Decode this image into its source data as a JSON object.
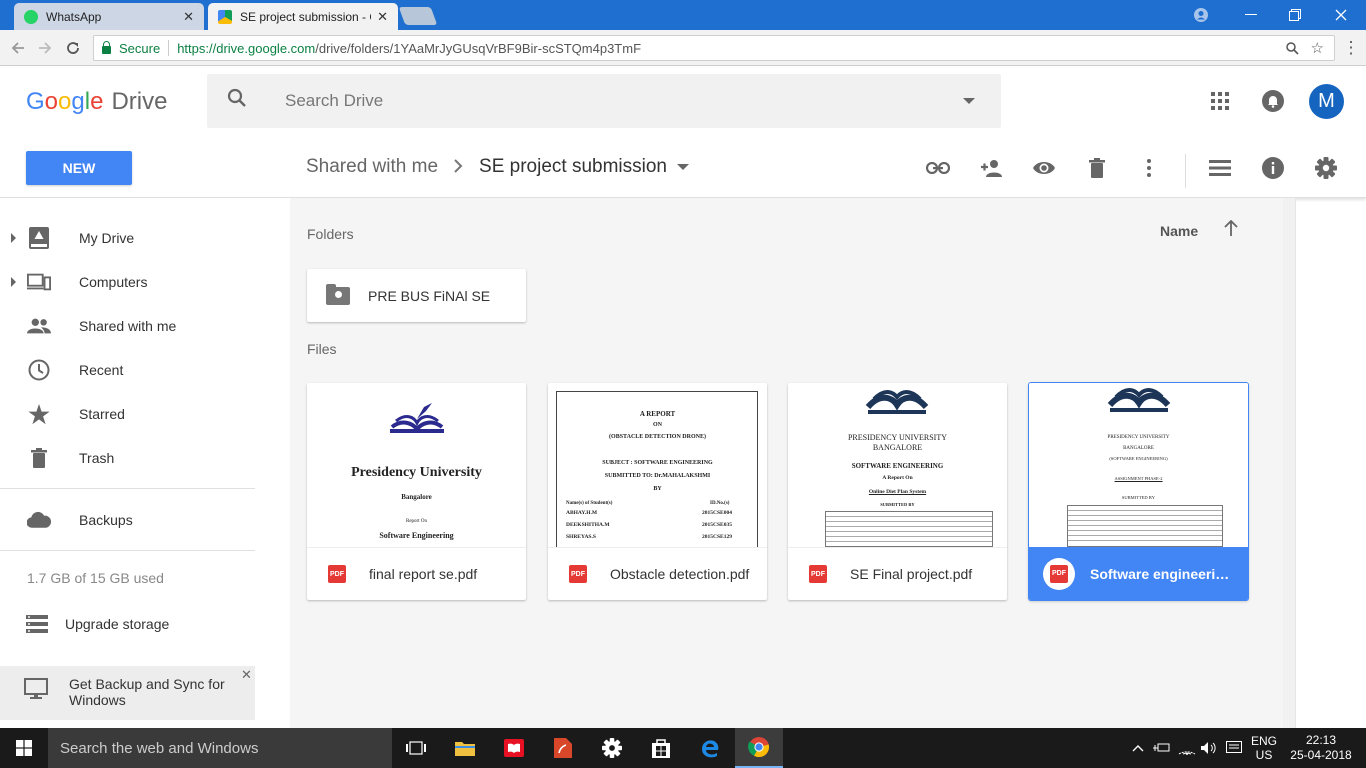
{
  "browser": {
    "tabs": [
      {
        "label": "WhatsApp",
        "icon": "whatsapp-icon",
        "active": false
      },
      {
        "label": "SE project submission - G",
        "icon": "google-drive-icon",
        "active": true
      }
    ],
    "close_glyph": "✕",
    "secure_label": "Secure",
    "url_domain": "https://drive.google.com",
    "url_path": "/drive/folders/1YAaMrJyGUsqVrBF9Bir-scSTQm4p3TmF"
  },
  "drive": {
    "logo_letters": [
      "G",
      "o",
      "o",
      "g",
      "l",
      "e"
    ],
    "logo_colors": [
      "#4285f4",
      "#ea4335",
      "#fbbc05",
      "#4285f4",
      "#34a853",
      "#ea4335"
    ],
    "logo_product": "Drive",
    "search_placeholder": "Search Drive",
    "avatar_initial": "M",
    "new_button": "NEW",
    "breadcrumb": {
      "parent": "Shared with me",
      "current": "SE project submission"
    },
    "sort_label": "Name",
    "accent_color": "#4285f4"
  },
  "nav": {
    "items": [
      {
        "label": "My Drive",
        "icon": "my-drive-icon"
      },
      {
        "label": "Computers",
        "icon": "computers-icon"
      },
      {
        "label": "Shared with me",
        "icon": "shared-icon"
      },
      {
        "label": "Recent",
        "icon": "clock-icon"
      },
      {
        "label": "Starred",
        "icon": "star-icon"
      },
      {
        "label": "Trash",
        "icon": "trash-icon"
      }
    ],
    "backups": "Backups",
    "storage": "1.7 GB of 15 GB used",
    "upgrade": "Upgrade storage",
    "backup_promo": "Get Backup and Sync for Windows"
  },
  "content": {
    "folders_title": "Folders",
    "files_title": "Files",
    "folders": [
      {
        "label": "PRE BUS FiNAl SE"
      }
    ],
    "files": [
      {
        "name": "final report se.pdf",
        "badge": "PDF"
      },
      {
        "name": "Obstacle detection.pdf",
        "badge": "PDF"
      },
      {
        "name": "SE Final project.pdf",
        "badge": "PDF"
      },
      {
        "name": "Software engineering.pdf",
        "badge": "PDF",
        "selected": true
      }
    ],
    "thumb1": {
      "title": "Presidency University",
      "city": "Bangalore",
      "report_on": "Report On",
      "subject": "Software Engineering"
    },
    "thumb2": {
      "l1": "A REPORT",
      "l2": "ON",
      "l3": "(OBSTACLE DETECTION DRONE)",
      "l4": "SUBJECT : SOFTWARE ENGINEERING",
      "l5": "SUBMITTED TO: Dr.MAHALAKSHMI",
      "l6": "BY",
      "col1": "Name(s) of Student(s)",
      "col2": "ID.No.(s)",
      "rows": [
        [
          "ABHAY.H.M",
          "2015CSE004"
        ],
        [
          "DEEKSHITHA.M",
          "2015CSE035"
        ],
        [
          "SHREYAS.S",
          "2015CSE129"
        ]
      ]
    },
    "thumb3": {
      "l1": "PRESIDENCY UNIVERSITY",
      "l2": "BANGALORE",
      "l3": "SOFTWARE ENGINEERING",
      "l4": "A Report On",
      "l5": "Online Diet Plan System",
      "l6": "SUBMITTED BY"
    },
    "thumb4": {
      "l1": "PRESIDENCY UNIVERSITY",
      "l2": "BANGALORE",
      "l3": "(SOFTWARE ENGINEERING)",
      "l4": "ASSIGNMENT PHASE-2",
      "l5": "SUBMITTED BY"
    }
  },
  "taskbar": {
    "search_placeholder": "Search the web and Windows",
    "lang1": "ENG",
    "lang2": "US",
    "time": "22:13",
    "date": "25-04-2018"
  }
}
